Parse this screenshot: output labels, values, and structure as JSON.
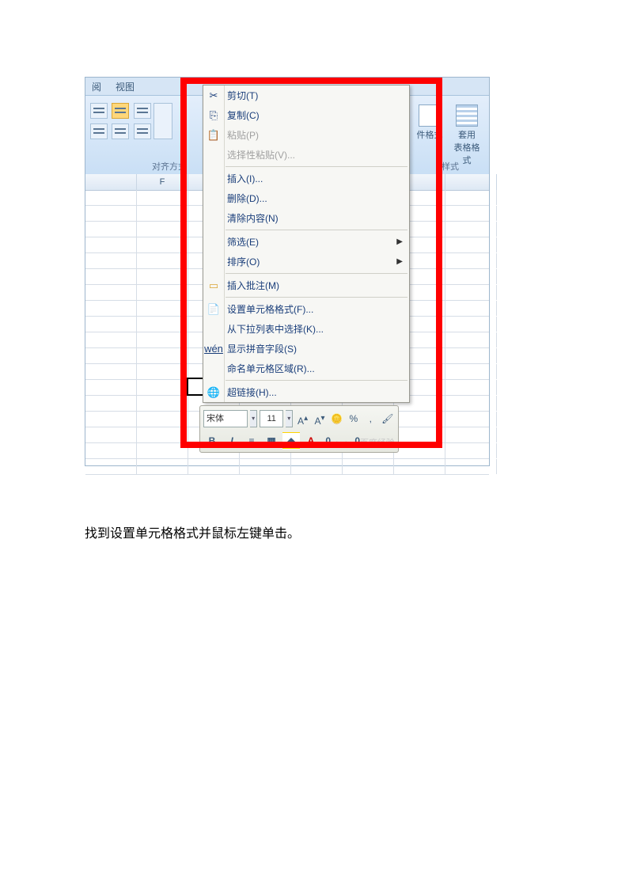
{
  "tabs": {
    "review": "阅",
    "view": "视图"
  },
  "ribbon": {
    "align_label": "对齐方式",
    "style_label": "样式",
    "cond_fmt": "件格式",
    "table_fmt_l1": "套用",
    "table_fmt_l2": "表格格式"
  },
  "cols": [
    "F"
  ],
  "menu": {
    "cut": "剪切(T)",
    "copy": "复制(C)",
    "paste": "粘贴(P)",
    "paste_special": "选择性粘贴(V)...",
    "insert": "插入(I)...",
    "delete": "删除(D)...",
    "clear": "清除内容(N)",
    "filter": "筛选(E)",
    "sort": "排序(O)",
    "comment": "插入批注(M)",
    "format_cells": "设置单元格格式(F)...",
    "dropdown": "从下拉列表中选择(K)...",
    "pinyin": "显示拼音字段(S)",
    "name_range": "命名单元格区域(R)...",
    "hyperlink": "超链接(H)..."
  },
  "mini": {
    "font": "宋体",
    "size": "11",
    "pct": "%"
  },
  "caption": "找到设置单元格格式并鼠标左键单击。",
  "watermark": "百度经验"
}
